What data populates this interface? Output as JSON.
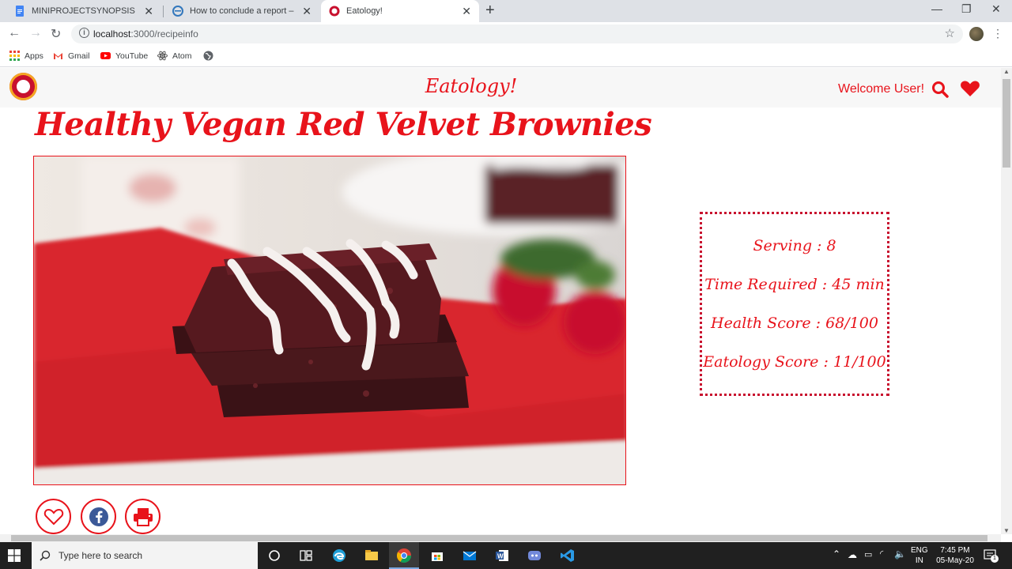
{
  "browser": {
    "tabs": [
      {
        "title": "MINIPROJECTSYNOPSIS - Google Docs",
        "active": false
      },
      {
        "title": "How to conclude a report – like a pro",
        "active": false
      },
      {
        "title": "Eatology!",
        "active": true
      }
    ],
    "url_host": "localhost",
    "url_path": ":3000/recipeinfo",
    "bookmarks": [
      "Apps",
      "Gmail",
      "YouTube",
      "Atom"
    ]
  },
  "site": {
    "brand": "Eatology!",
    "welcome": "Welcome User!"
  },
  "recipe": {
    "title": "Healthy Vegan Red Velvet Brownies",
    "serving": "Serving : 8",
    "time": "Time Required : 45 min",
    "health_score": "Health Score : 68/100",
    "eatology_score": "Eatology Score : 11/100"
  },
  "taskbar": {
    "search_placeholder": "Type here to search",
    "lang_top": "ENG",
    "lang_bottom": "IN",
    "time": "7:45 PM",
    "date": "05-May-20",
    "notification_count": "1"
  },
  "colors": {
    "brand_red": "#e8131b",
    "tab_bar": "#dee1e6",
    "taskbar": "#202020"
  }
}
